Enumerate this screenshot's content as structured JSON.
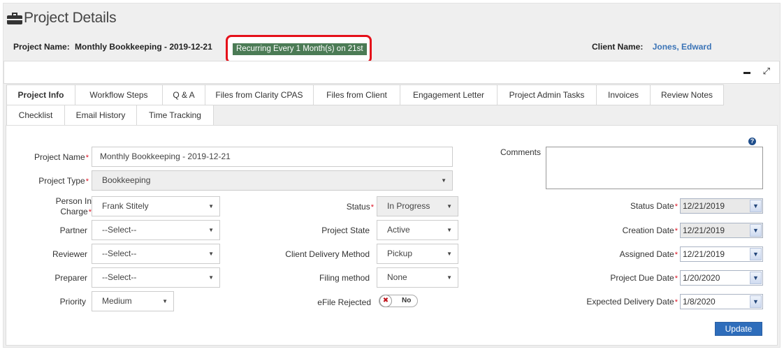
{
  "page": {
    "title": "Project Details"
  },
  "header": {
    "project_name_label": "Project Name:",
    "project_name_value": "Monthly Bookkeeping - 2019-12-21",
    "recurring_badge": "Recurring Every 1 Month(s) on 21st",
    "client_name_label": "Client Name:",
    "client_name_value": "Jones, Edward",
    "highlight_color": "#e5101a",
    "badge_color": "#4b7b55"
  },
  "toolbar": {
    "minimize_icon": "minus-icon",
    "expand_icon": "expand-arrows-icon"
  },
  "tabs": [
    {
      "label": "Project Info",
      "active": true
    },
    {
      "label": "Workflow Steps"
    },
    {
      "label": "Q & A"
    },
    {
      "label": "Files from Clarity CPAS"
    },
    {
      "label": "Files from Client"
    },
    {
      "label": "Engagement Letter"
    },
    {
      "label": "Project Admin Tasks"
    },
    {
      "label": "Invoices"
    },
    {
      "label": "Review Notes"
    },
    {
      "label": "Checklist"
    },
    {
      "label": "Email History"
    },
    {
      "label": "Time Tracking"
    }
  ],
  "form": {
    "project_name": {
      "label": "Project Name",
      "value": "Monthly Bookkeeping - 2019-12-21"
    },
    "project_type": {
      "label": "Project Type",
      "value": "Bookkeeping"
    },
    "person_in_charge": {
      "label_line1": "Person In",
      "label_line2": "Charge",
      "value": "Frank Stitely"
    },
    "partner": {
      "label": "Partner",
      "value": "--Select--"
    },
    "reviewer": {
      "label": "Reviewer",
      "value": "--Select--"
    },
    "preparer": {
      "label": "Preparer",
      "value": "--Select--"
    },
    "priority": {
      "label": "Priority",
      "value": "Medium"
    },
    "status": {
      "label": "Status",
      "value": "In Progress"
    },
    "project_state": {
      "label": "Project State",
      "value": "Active"
    },
    "client_delivery_method": {
      "label": "Client Delivery Method",
      "value": "Pickup"
    },
    "filing_method": {
      "label": "Filing method",
      "value": "None"
    },
    "efile_rejected": {
      "label": "eFile Rejected",
      "toggle_text": "No",
      "knob": "✖"
    },
    "comments": {
      "label": "Comments",
      "value": ""
    },
    "status_date": {
      "label": "Status Date",
      "value": "12/21/2019"
    },
    "creation_date": {
      "label": "Creation Date",
      "value": "12/21/2019"
    },
    "assigned_date": {
      "label": "Assigned Date",
      "value": "12/21/2019"
    },
    "project_due_date": {
      "label": "Project Due Date",
      "value": "1/20/2020"
    },
    "expected_delivery_date": {
      "label": "Expected Delivery Date",
      "value": "1/8/2020"
    },
    "required_mark": "*",
    "help_icon": "?",
    "update_button": "Update"
  }
}
